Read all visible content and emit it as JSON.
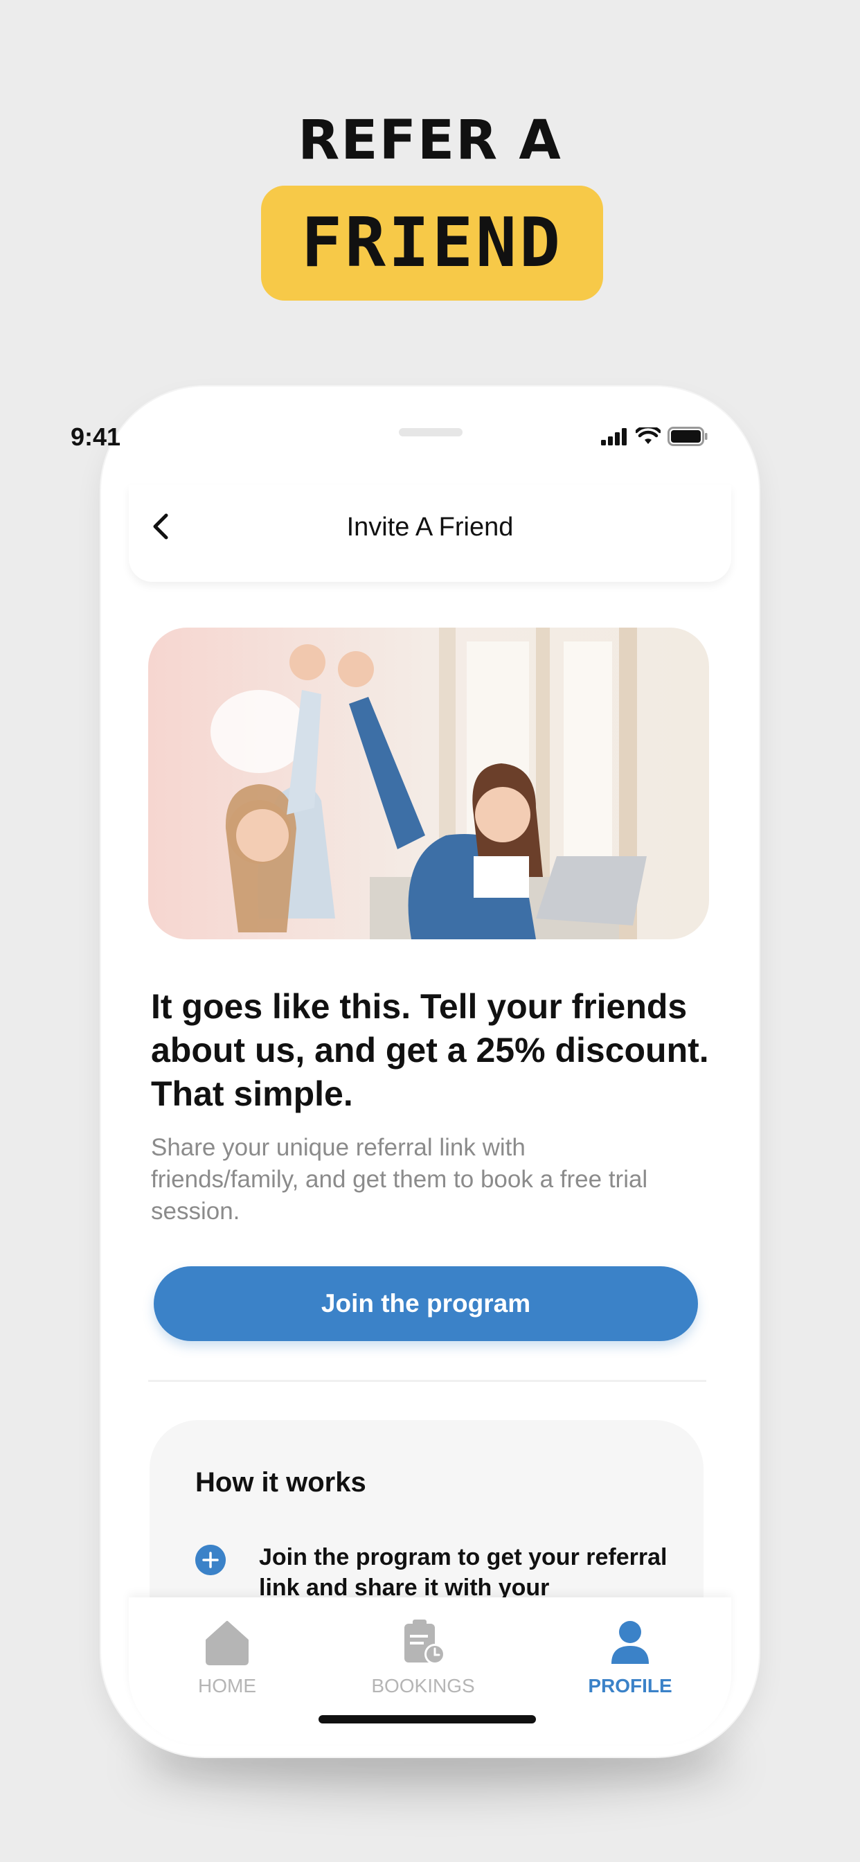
{
  "promo": {
    "line1": "REFER A",
    "line2": "FRIEND",
    "accent_color": "#f7c948"
  },
  "status_bar": {
    "time": "9:41",
    "icons": [
      "cellular-signal-icon",
      "wifi-icon",
      "battery-icon"
    ]
  },
  "header": {
    "title": "Invite A Friend",
    "back_icon": "chevron-left-icon"
  },
  "content": {
    "headline": "It goes like this. Tell your friends about us, and get a 25% discount. That simple.",
    "description": "Share your unique referral link with friends/family, and get them to book a free trial session.",
    "cta_label": "Join the program",
    "cta_color": "#3b82c8"
  },
  "how_it_works": {
    "title": "How it works",
    "steps": [
      {
        "icon": "plus-circle-icon",
        "text": "Join the program to get your referral link and share it with your"
      }
    ]
  },
  "tabbar": {
    "items": [
      {
        "label": "HOME",
        "icon": "home-icon",
        "active": false
      },
      {
        "label": "BOOKINGS",
        "icon": "clipboard-clock-icon",
        "active": false
      },
      {
        "label": "PROFILE",
        "icon": "user-icon",
        "active": true
      }
    ],
    "active_color": "#3b82c8",
    "inactive_color": "#b5b5b5"
  }
}
